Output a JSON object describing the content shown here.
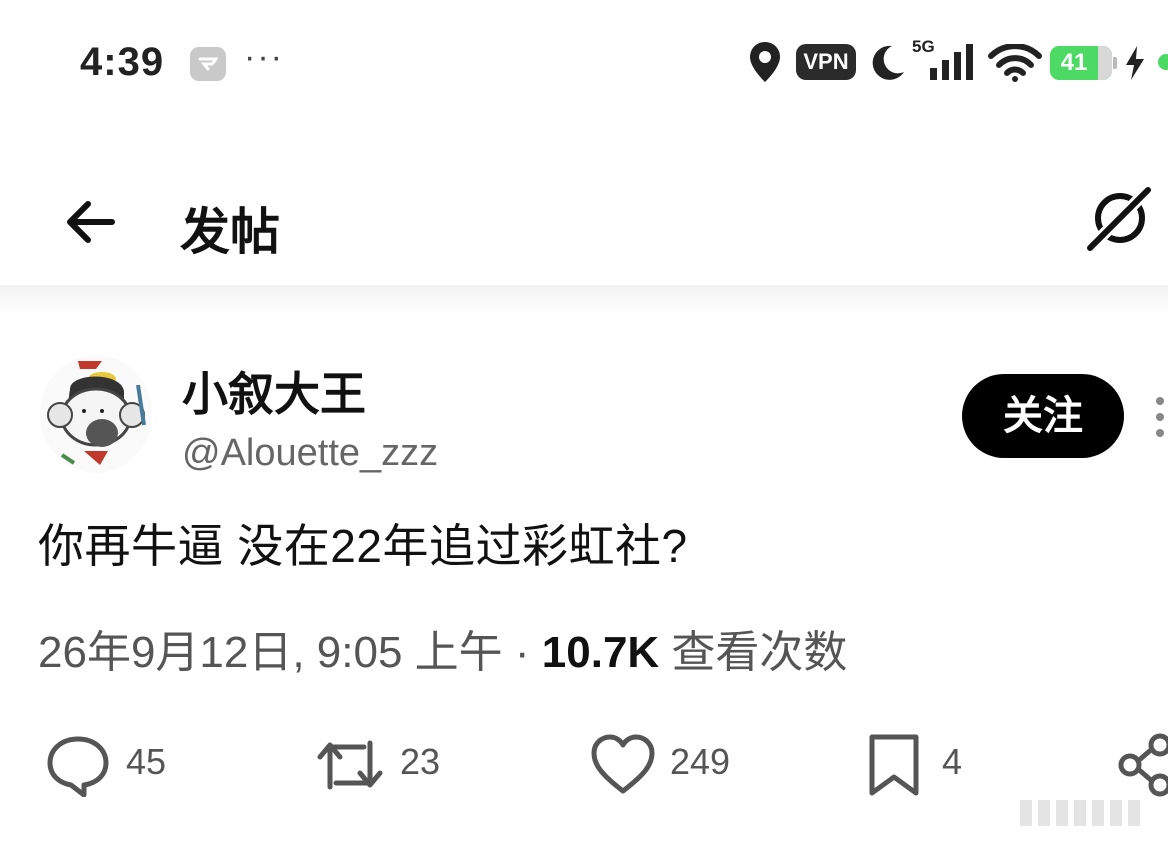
{
  "status_bar": {
    "time": "4:39",
    "more": "···",
    "vpn": "VPN",
    "network": "5G",
    "battery": "41",
    "icons": [
      "app-icon",
      "location-icon",
      "moon-icon",
      "signal-icon",
      "wifi-icon",
      "bolt-icon"
    ]
  },
  "header": {
    "title": "发帖",
    "back_icon": "arrow-left-icon",
    "right_icon": "grok-icon"
  },
  "post": {
    "display_name": "小叙大王",
    "handle": "@Alouette_zzz",
    "follow_label": "关注",
    "text": "你再牛逼 没在22年追过彩虹社?",
    "timestamp": "26年9月12日, 9:05 上午",
    "separator": " · ",
    "views_count": "10.7K",
    "views_label": " 查看次数"
  },
  "actions": {
    "reply_count": "45",
    "retweet_count": "23",
    "like_count": "249",
    "bookmark_count": "4"
  }
}
